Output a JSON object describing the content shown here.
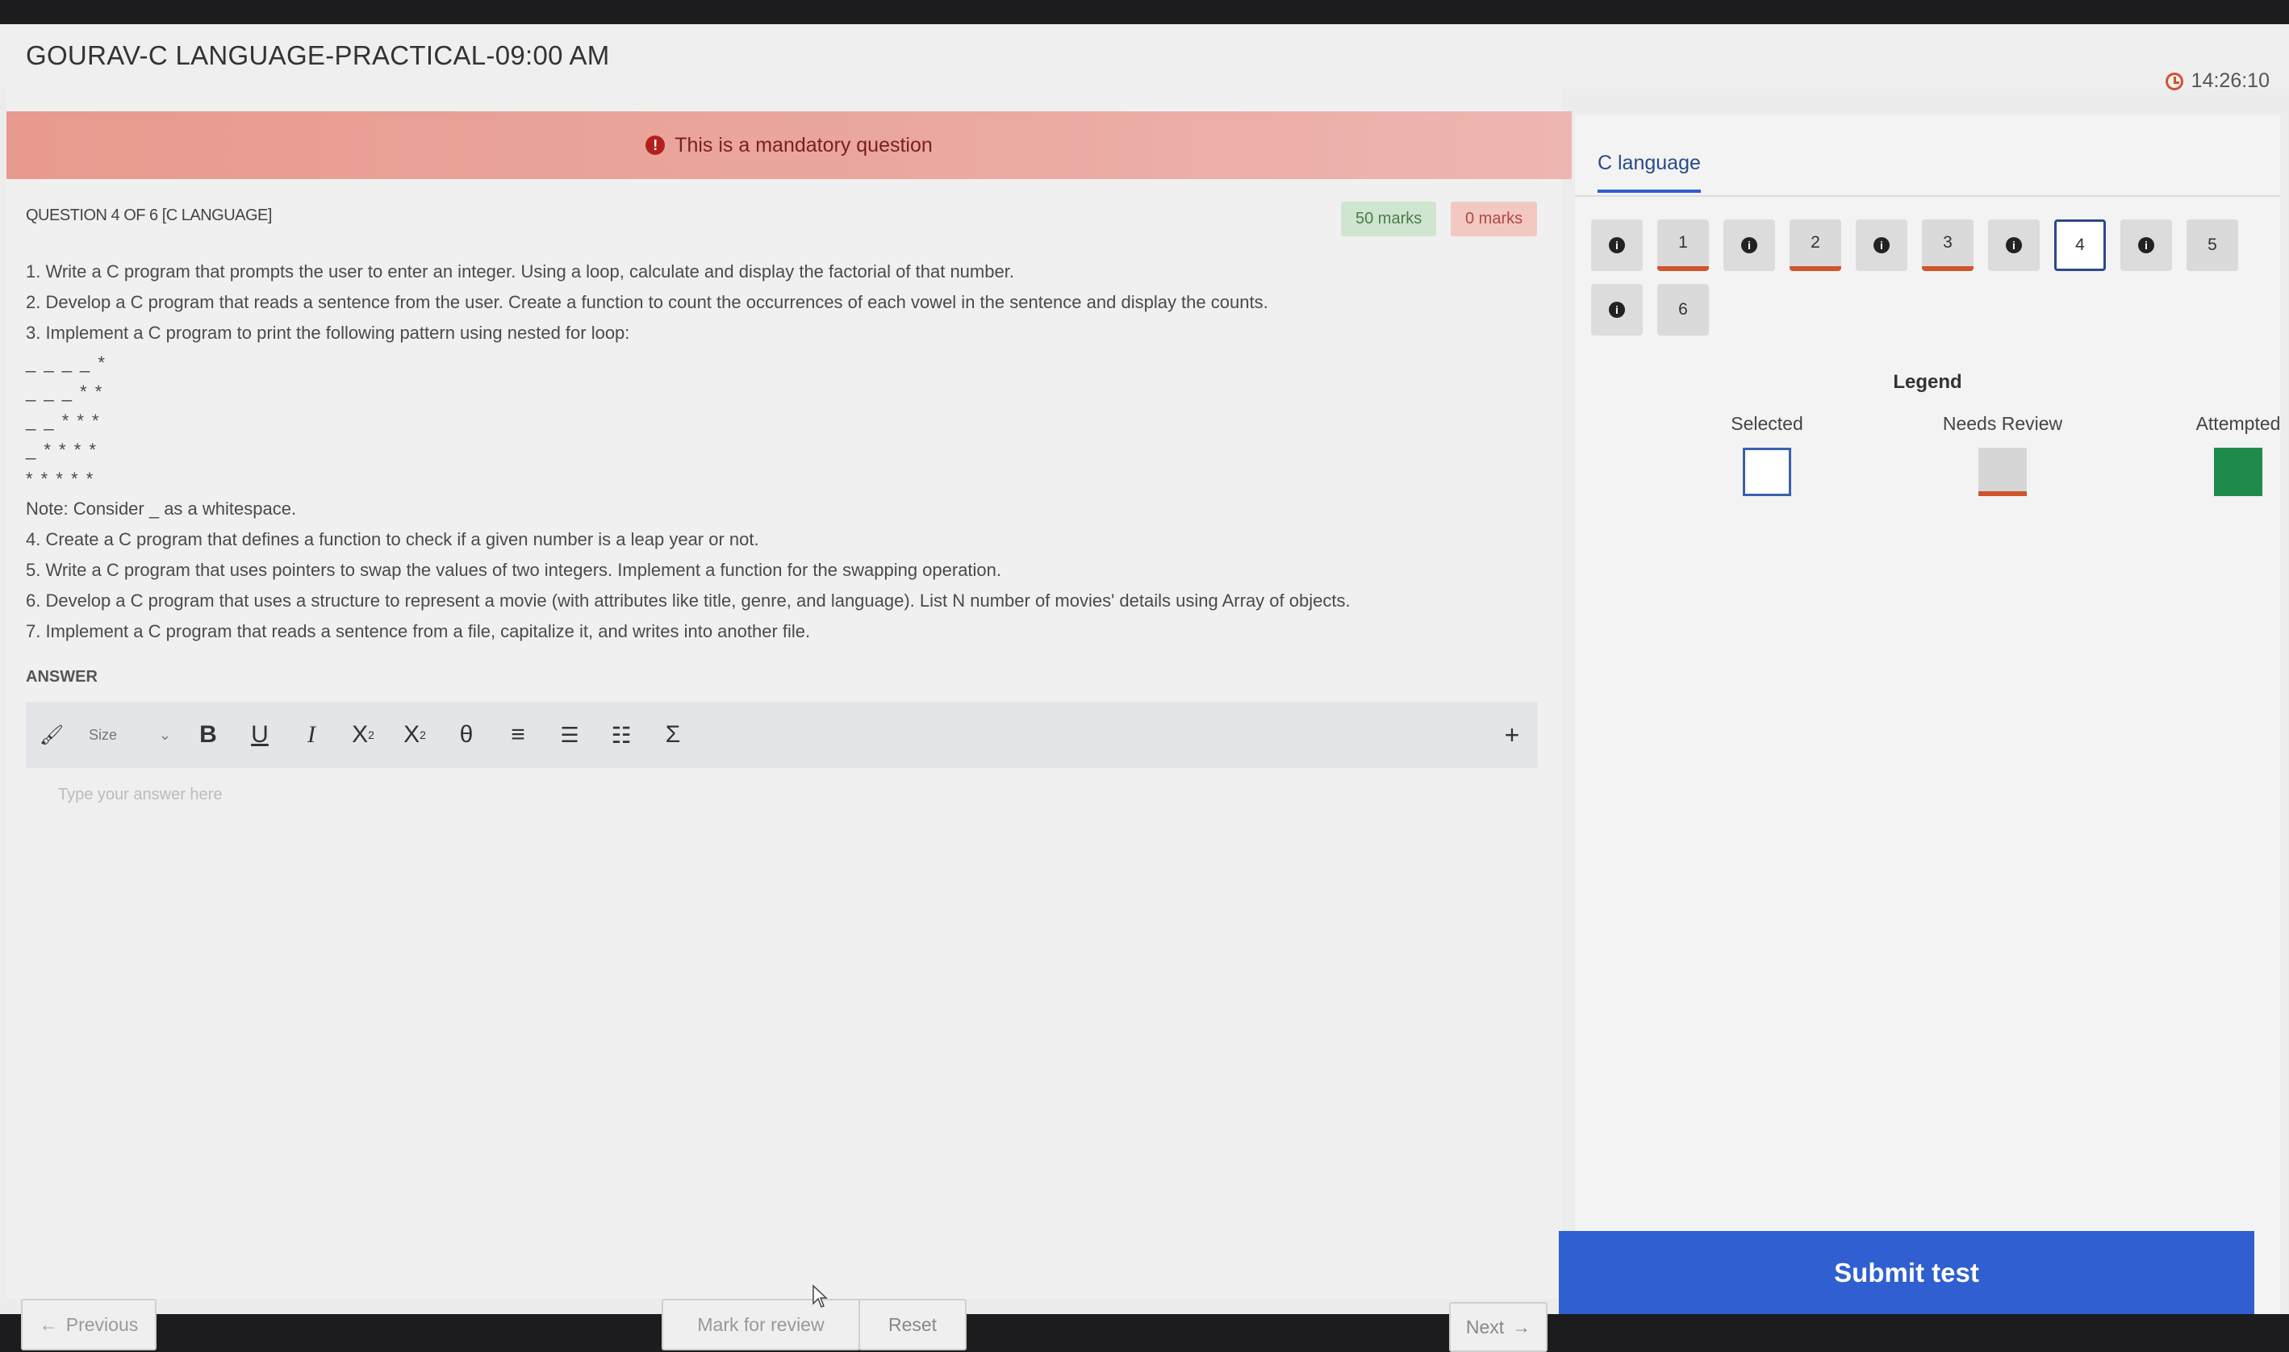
{
  "header": {
    "title": "GOURAV-C LANGUAGE-PRACTICAL-09:00 AM",
    "timer": "14:26:10"
  },
  "banner": {
    "text": "This is a mandatory question"
  },
  "question": {
    "meta": "QUESTION 4 OF 6 [C LANGUAGE]",
    "marks_positive": "50 marks",
    "marks_negative": "0 marks",
    "lines": [
      "1. Write a C program that prompts the user to enter an integer. Using a loop, calculate and display the factorial of that number.",
      "2. Develop a C program that reads a sentence from the user. Create a function to count the occurrences of each vowel in the sentence and display the counts.",
      "3. Implement a C program to print the following pattern using nested for loop:"
    ],
    "pattern": [
      "_ _ _ _ *",
      "_ _ _ * *",
      "_ _ * * *",
      "_ * * * *",
      "* * * * *"
    ],
    "lines_after": [
      "Note: Consider _ as a whitespace.",
      "4. Create a C program that defines a function to check if a given number is a leap year or not.",
      "5. Write a C program that uses pointers to swap the values of two integers. Implement a function for the swapping operation.",
      "6. Develop a C program that uses a structure to represent a movie (with attributes like title, genre, and language). List N number of movies' details using Array of objects.",
      "7. Implement a C program that reads a sentence from a file, capitalize it, and writes into another file."
    ]
  },
  "answer": {
    "label": "ANSWER",
    "size_label": "Size",
    "placeholder": "Type your answer here"
  },
  "toolbar_icons": [
    "paint-format-icon",
    "bold-icon",
    "underline-icon",
    "italic-icon",
    "subscript-icon",
    "superscript-icon",
    "theta-icon",
    "align-icon",
    "ordered-list-icon",
    "table-icon",
    "sigma-icon",
    "plus-icon"
  ],
  "nav": {
    "previous": "Previous",
    "mark_for_review": "Mark for review",
    "reset": "Reset",
    "next": "Next"
  },
  "sidebar": {
    "section": "C language",
    "questions": [
      {
        "num": "1",
        "state": "review"
      },
      {
        "num": "2",
        "state": "review"
      },
      {
        "num": "3",
        "state": "review"
      },
      {
        "num": "4",
        "state": "selected"
      },
      {
        "num": "5",
        "state": "normal"
      },
      {
        "num": "6",
        "state": "normal"
      }
    ],
    "legend_title": "Legend",
    "legend": {
      "selected": "Selected",
      "needs_review": "Needs Review",
      "attempted": "Attempted"
    },
    "submit": "Submit test"
  },
  "colors": {
    "accent": "#2f5fd0",
    "review": "#d0542c",
    "attempted": "#1e8b4a",
    "banner": "#e89a8e"
  }
}
